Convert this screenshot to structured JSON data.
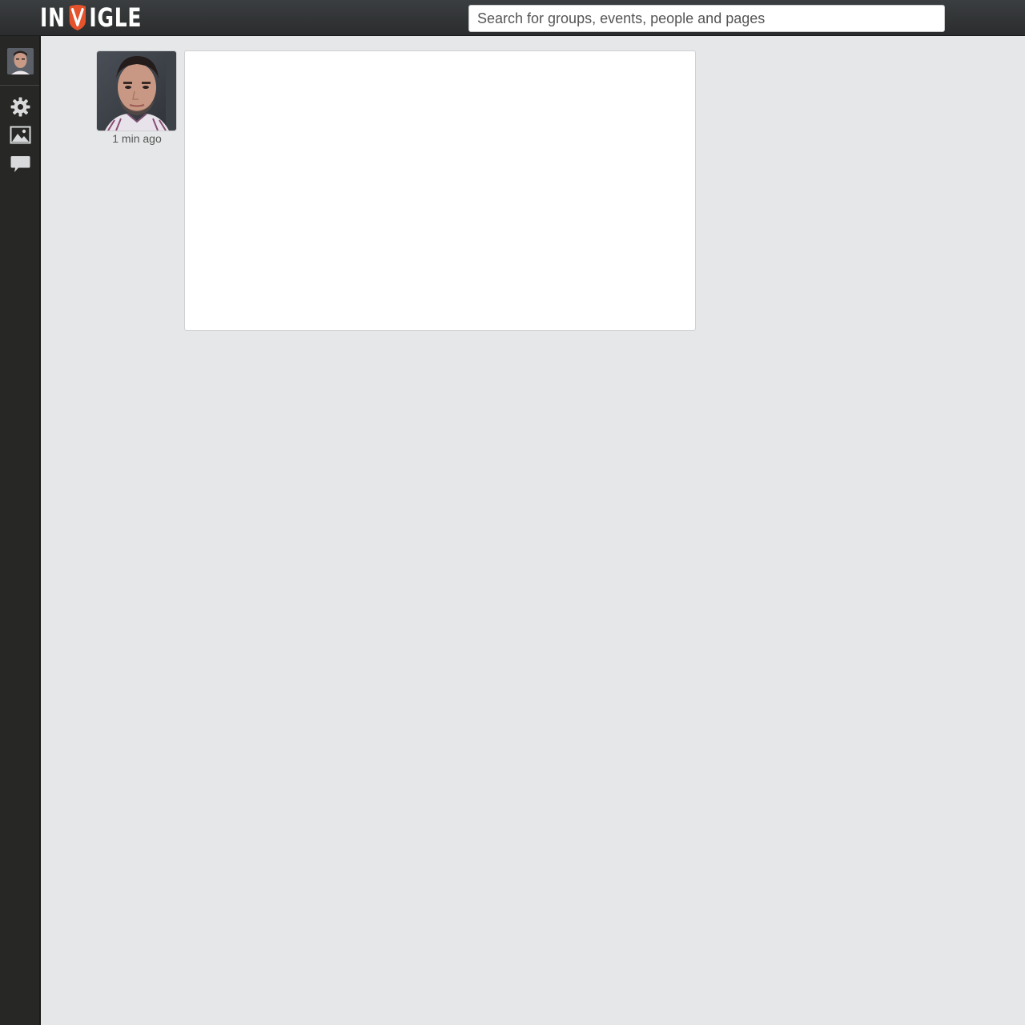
{
  "app": {
    "logo_text_left": "IN",
    "logo_text_right": "IGLE",
    "logo_mark": "v-badge-logo",
    "brand_color": "#e5532c"
  },
  "header": {
    "search_placeholder": "Search for groups, events, people and pages"
  },
  "sidebar": {
    "icons": [
      "settings-gear-icon",
      "photo-icon",
      "chat-bubble-icon"
    ]
  },
  "feed": {
    "post": {
      "timestamp": "1 min ago"
    }
  }
}
